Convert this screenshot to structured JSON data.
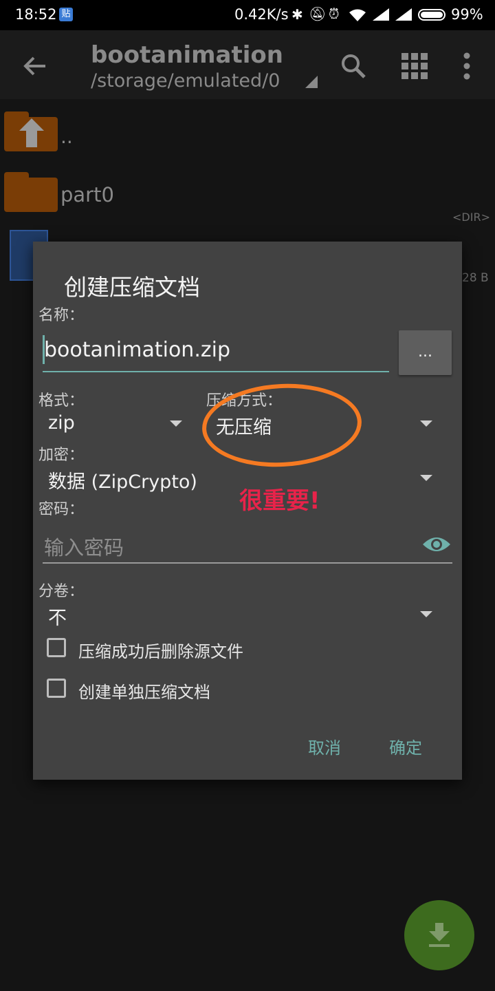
{
  "status_bar": {
    "time": "18:52",
    "notif_badge": "贴",
    "net_speed": "0.42K/s",
    "battery": "99%"
  },
  "app_bar": {
    "title": "bootanimation",
    "path": "/storage/emulated/0"
  },
  "file_list": {
    "items": [
      {
        "name": ".."
      },
      {
        "name": "part0",
        "meta": "<DIR>"
      },
      {
        "meta": "28 B"
      }
    ]
  },
  "dialog": {
    "title": "创建压缩文档",
    "name_label": "名称：",
    "name_value": "bootanimation.zip",
    "browse_label": "...",
    "format_label": "格式：",
    "format_value": "zip",
    "compression_label": "压缩方式：",
    "compression_value": "无压缩",
    "encryption_label": "加密：",
    "encryption_value": "数据 (ZipCrypto)",
    "password_label": "密码：",
    "password_placeholder": "输入密码",
    "split_label": "分卷：",
    "split_value": "不",
    "checkbox_delete": "压缩成功后删除源文件",
    "checkbox_separate": "创建单独压缩文档",
    "cancel": "取消",
    "ok": "确定"
  },
  "annotation": {
    "text": "很重要!",
    "color": "#e8234a",
    "circle_color": "#f57a22"
  },
  "colors": {
    "accent": "#6fb1ab",
    "fab": "#3d6b1e"
  }
}
